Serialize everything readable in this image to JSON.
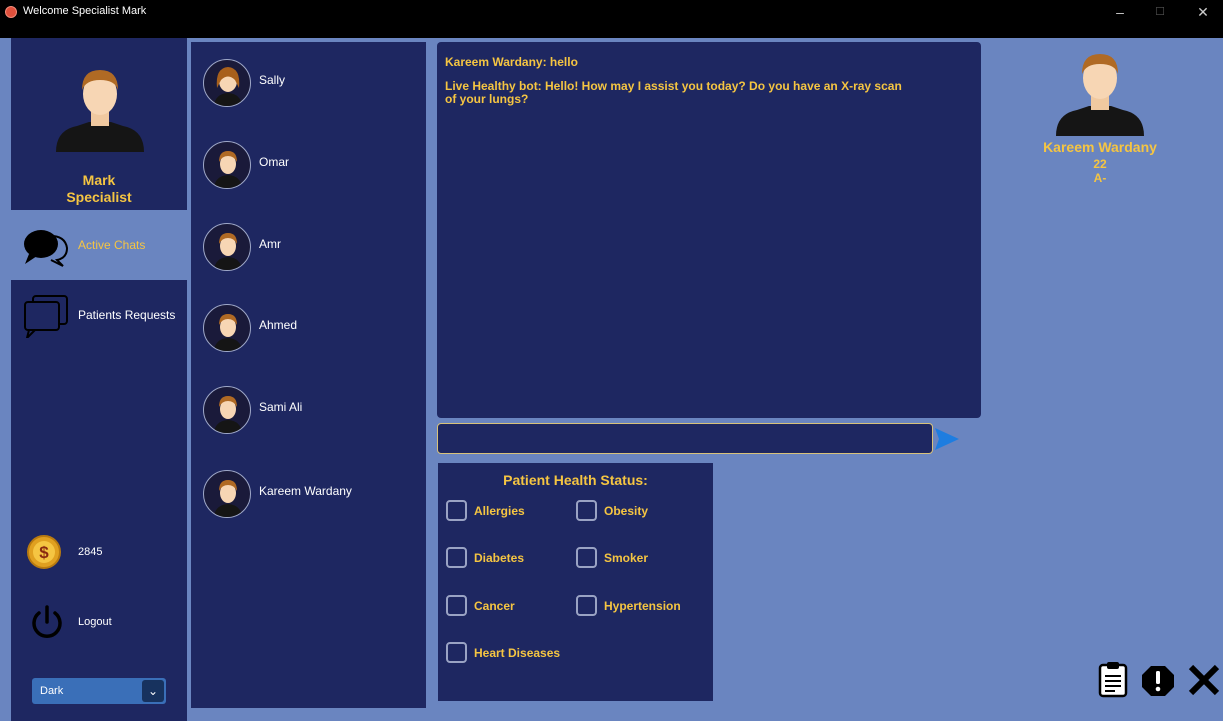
{
  "window": {
    "title": "Welcome Specialist Mark",
    "minimize": "–",
    "maximize": "☐",
    "close": "✕"
  },
  "user": {
    "name": "Mark",
    "role": "Specialist"
  },
  "nav": [
    {
      "label": "Active Chats",
      "icon": "chat-bubble-icon",
      "active": true
    },
    {
      "label": "Patients Requests",
      "icon": "requests-icon",
      "active": false
    }
  ],
  "coins": {
    "value": "2845",
    "icon": "dollar-coin-icon"
  },
  "logout": {
    "label": "Logout",
    "icon": "power-icon"
  },
  "theme": {
    "value": "Dark",
    "arrow": "⌄"
  },
  "contacts": [
    "Sally",
    "Omar",
    "Amr",
    "Ahmed",
    "Sami Ali",
    "Kareem Wardany"
  ],
  "chat": {
    "messages": [
      "Kareem Wardany: hello",
      "Live Healthy bot: Hello! How may I assist you today? Do you have an X-ray scan of your lungs?"
    ],
    "input_value": ""
  },
  "health_status": {
    "title": "Patient Health Status:",
    "conditions": [
      "Allergies",
      "Obesity",
      "Diabetes",
      "Smoker",
      "Cancer",
      "Hypertension",
      "Heart Diseases"
    ]
  },
  "patient": {
    "name": "Kareem Wardany",
    "age": "22",
    "blood_type": "A-"
  },
  "colors": {
    "panel": "#1e2761",
    "background": "#6a85c0",
    "accent": "#f5c542"
  }
}
